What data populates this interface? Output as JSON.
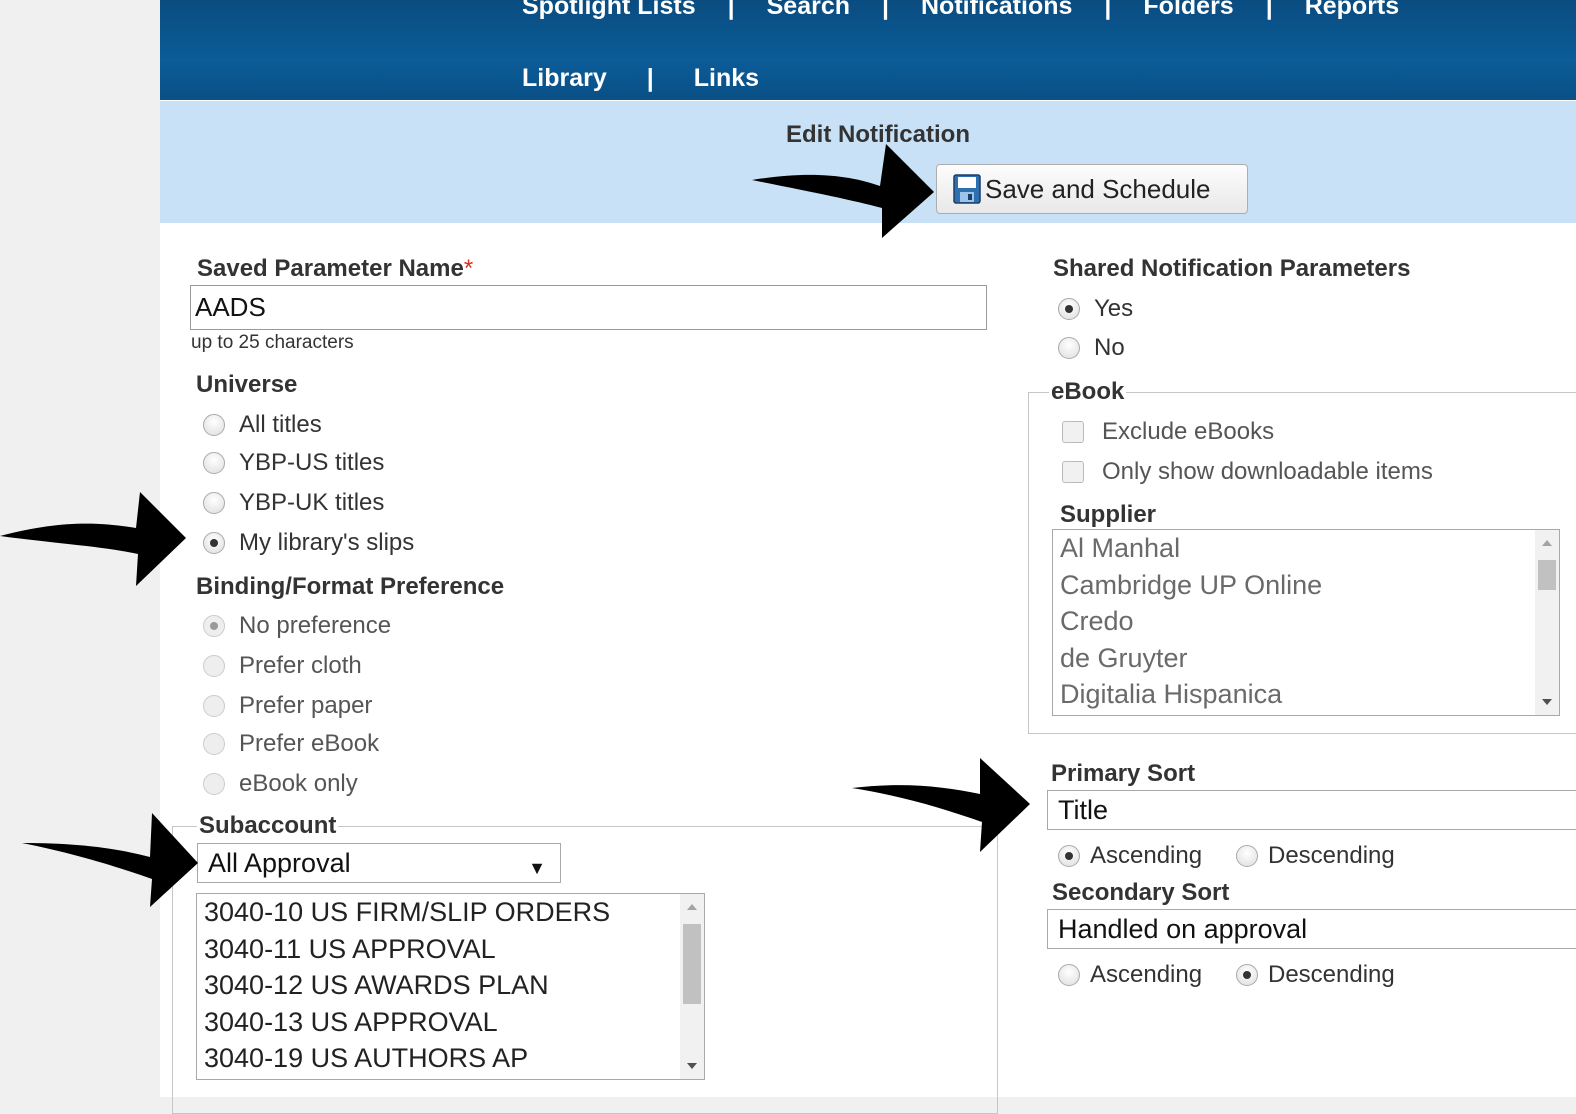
{
  "nav": {
    "row1": [
      "Spotlight Lists",
      "Search",
      "Notifications",
      "Folders",
      "Reports"
    ],
    "row2": [
      "Library",
      "Links"
    ],
    "separator": "|"
  },
  "header": {
    "title": "Edit Notification",
    "save_button": "Save and Schedule"
  },
  "saved_param": {
    "label": "Saved Parameter Name",
    "required_marker": "*",
    "value": "AADS",
    "hint": "up to 25 characters"
  },
  "universe": {
    "label": "Universe",
    "options": [
      "All titles",
      "YBP-US titles",
      "YBP-UK titles",
      "My library's slips"
    ],
    "selected": "My library's slips"
  },
  "binding": {
    "label": "Binding/Format Preference",
    "options": [
      "No preference",
      "Prefer cloth",
      "Prefer paper",
      "Prefer eBook",
      "eBook only"
    ],
    "selected": "No preference"
  },
  "subaccount": {
    "label": "Subaccount",
    "select_value": "All Approval",
    "caret": "▼",
    "items": [
      "3040-10 US FIRM/SLIP ORDERS",
      "3040-11 US APPROVAL",
      "3040-12 US AWARDS PLAN",
      "3040-13 US APPROVAL",
      "3040-19 US AUTHORS AP"
    ]
  },
  "shared": {
    "label": "Shared Notification Parameters",
    "options": [
      "Yes",
      "No"
    ],
    "selected": "Yes"
  },
  "ebook": {
    "legend": "eBook",
    "checkboxes": [
      "Exclude eBooks",
      "Only show downloadable items"
    ],
    "supplier_label": "Supplier",
    "suppliers": [
      "Al Manhal",
      "Cambridge UP Online",
      "Credo",
      "de Gruyter",
      "Digitalia Hispanica"
    ]
  },
  "primary_sort": {
    "label": "Primary Sort",
    "value": "Title",
    "ascending": "Ascending",
    "descending": "Descending",
    "selected": "Ascending"
  },
  "secondary_sort": {
    "label": "Secondary Sort",
    "value": "Handled on approval",
    "ascending": "Ascending",
    "descending": "Descending",
    "selected": "Descending"
  },
  "colors": {
    "nav_bg": "#0b5c98",
    "band_bg": "#c9e1f7",
    "required": "#d9301f"
  }
}
